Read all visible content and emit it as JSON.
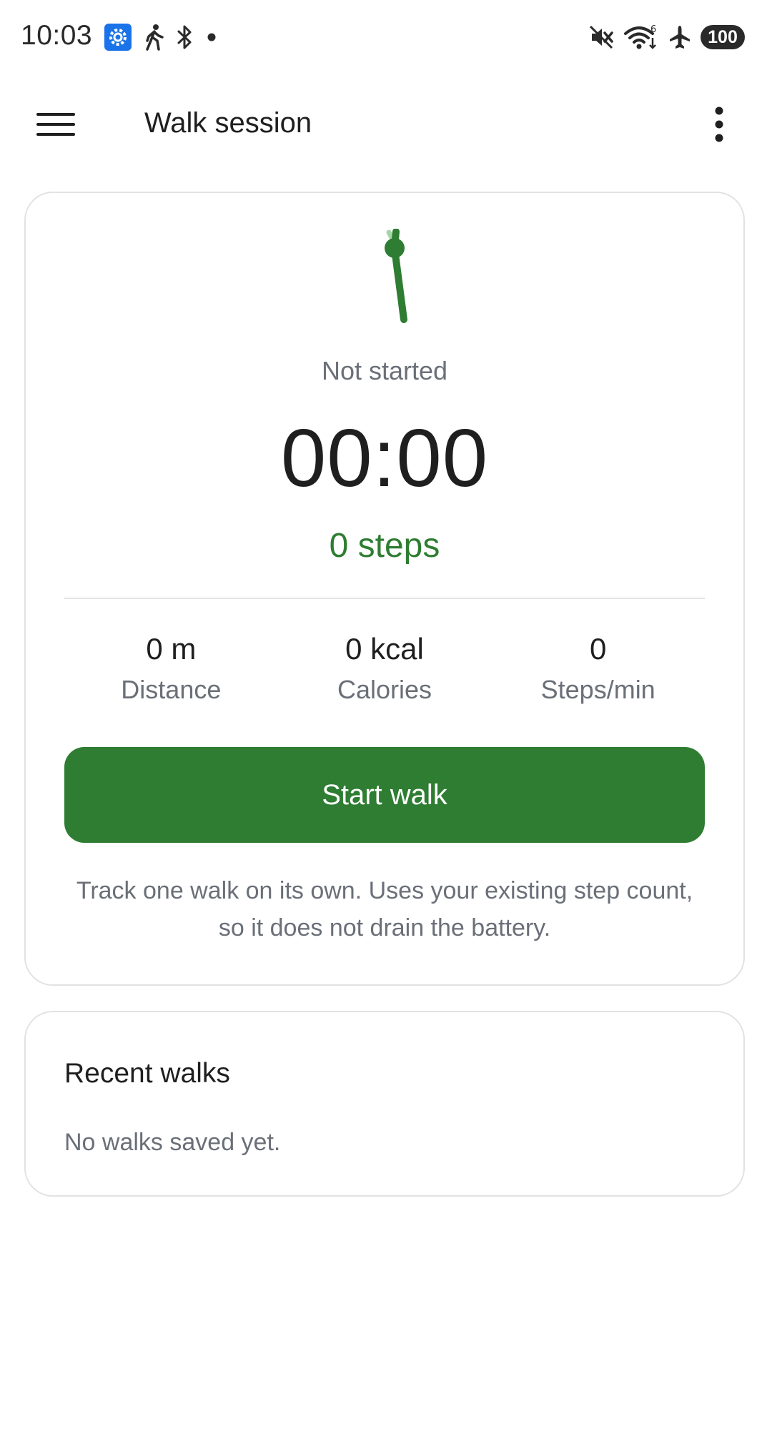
{
  "status_bar": {
    "time": "10:03",
    "battery_level": "100",
    "left_icons": [
      "settings-app-icon",
      "walk-notification-icon",
      "bluetooth-icon",
      "notification-dot-icon"
    ],
    "right_icons": [
      "vibrate-mute-icon",
      "wifi-icon",
      "airplane-mode-icon",
      "battery-icon"
    ]
  },
  "app_bar": {
    "title": "Walk session",
    "menu_icon": "hamburger-menu-icon",
    "overflow_icon": "more-vert-icon"
  },
  "session": {
    "status": "Not started",
    "timer": "00:00",
    "steps": "0 steps",
    "stats": [
      {
        "value": "0 m",
        "label": "Distance"
      },
      {
        "value": "0 kcal",
        "label": "Calories"
      },
      {
        "value": "0",
        "label": "Steps/min"
      }
    ],
    "start_button_label": "Start walk",
    "helper_text": "Track one walk on its own. Uses your existing step count, so it does not drain the battery."
  },
  "recent": {
    "title": "Recent walks",
    "empty_text": "No walks saved yet."
  },
  "colors": {
    "accent_green": "#2e7d32",
    "light_green": "#a5d6a7",
    "secondary_text": "#6a6f78",
    "card_border": "#e2e2e2"
  }
}
